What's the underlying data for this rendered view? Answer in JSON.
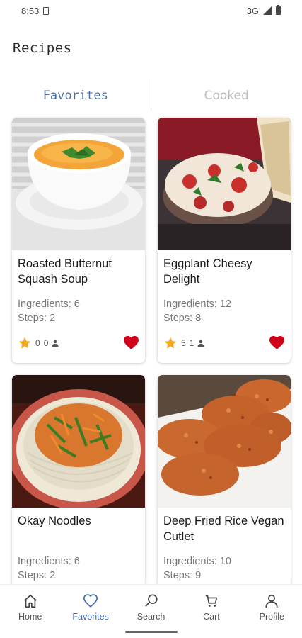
{
  "status_bar": {
    "time": "8:53",
    "network": "3G"
  },
  "page_title": "Recipes",
  "tabs": [
    {
      "label": "Favorites",
      "active": true
    },
    {
      "label": "Cooked",
      "active": false
    }
  ],
  "recipes": [
    {
      "title": "Roasted Butternut Squash Soup",
      "ingredients": "Ingredients: 6",
      "steps": "Steps: 2",
      "rating": "0",
      "count": "0",
      "favorite": true
    },
    {
      "title": "Eggplant Cheesy Delight",
      "ingredients": "Ingredients: 12",
      "steps": "Steps: 8",
      "rating": "5",
      "count": "1",
      "favorite": true
    },
    {
      "title": "Okay Noodles",
      "ingredients": "Ingredients: 6",
      "steps": "Steps: 2"
    },
    {
      "title": "Deep Fried Rice Vegan Cutlet",
      "ingredients": "Ingredients: 10",
      "steps": "Steps: 9"
    }
  ],
  "bottom_nav": [
    {
      "label": "Home",
      "icon": "home-icon"
    },
    {
      "label": "Favorites",
      "icon": "heart-outline-icon",
      "active": true
    },
    {
      "label": "Search",
      "icon": "search-icon"
    },
    {
      "label": "Cart",
      "icon": "cart-icon"
    },
    {
      "label": "Profile",
      "icon": "profile-icon"
    }
  ],
  "colors": {
    "accent": "#3f68b5",
    "heart": "#d0021b",
    "star": "#f5a623"
  }
}
